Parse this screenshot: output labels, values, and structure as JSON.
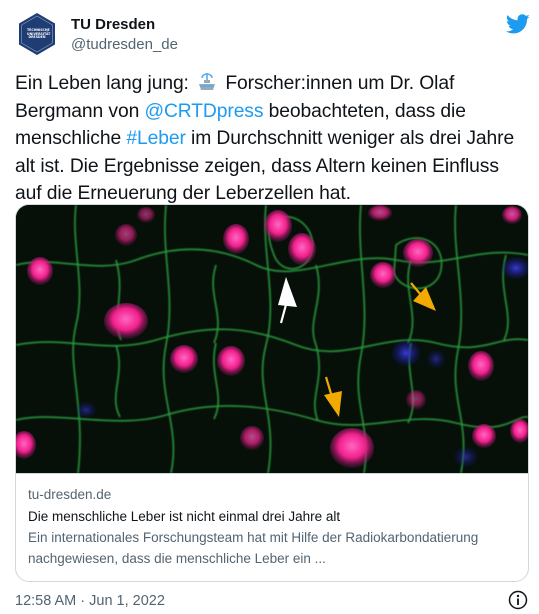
{
  "author": {
    "name": "TU Dresden",
    "handle": "@tudresden_de",
    "avatar_icon": "university-seal-icon",
    "avatar_text": "TECHNISCHE UNIVERSITÄT DRESDEN"
  },
  "platform_icon": "twitter-bird-icon",
  "tweet": {
    "part1": "Ein Leben lang jung: ",
    "emoji": "fountain-emoji",
    "part2": " Forscher:innen um Dr. Olaf Bergmann von ",
    "mention": "@CRTDpress",
    "part3": " beobachteten, dass die menschliche ",
    "hashtag": "#Leber",
    "part4": " im Durchschnitt weniger als drei Jahre alt ist. Die Ergebnisse zeigen, dass Altern keinen Einfluss auf die Erneuerung der Leberzellen hat."
  },
  "card": {
    "image_description_icon": "liver-cells-microscopy-image",
    "domain": "tu-dresden.de",
    "title": "Die menschliche Leber ist nicht einmal drei Jahre alt",
    "description": "Ein internationales Forschungsteam hat mit Hilfe der Radiokarbondatierung nachgewiesen, dass die menschliche Leber ein ..."
  },
  "timestamp": "12:58 AM · Jun 1, 2022",
  "colors": {
    "link": "#1d9bf0",
    "secondary_text": "#536471",
    "avatar_bg": "#1f3c73",
    "arrow_white": "#ffffff",
    "arrow_yellow": "#f2a900",
    "nucleus": "#ff2a9a",
    "membrane": "#2fa844"
  }
}
